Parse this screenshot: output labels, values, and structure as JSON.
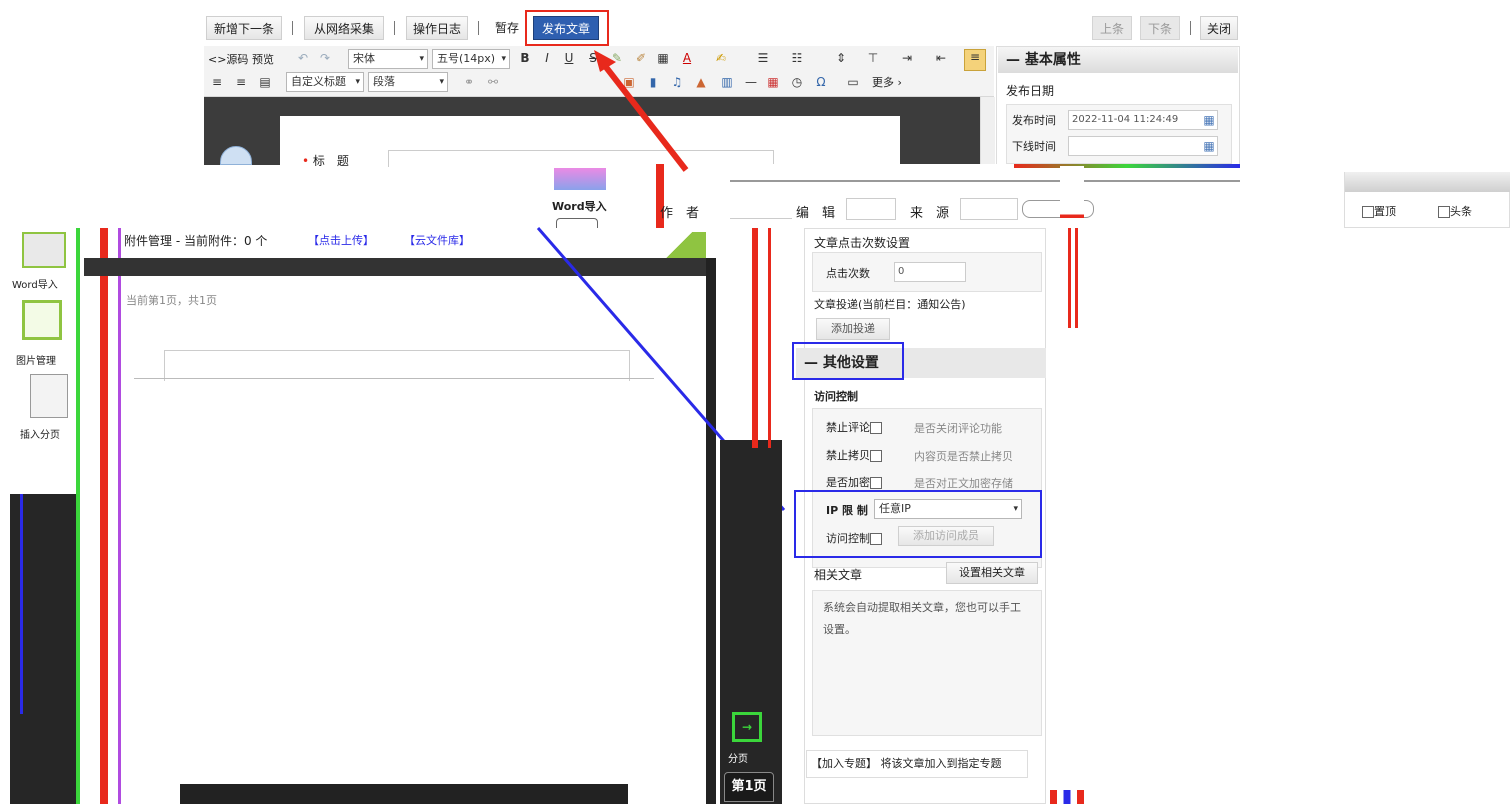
{
  "toolbar": {
    "new_next": "新增下一条",
    "collect": "从网络采集",
    "op_log": "操作日志",
    "draft": "暂存",
    "publish": "发布文章",
    "prev": "上条",
    "next": "下条",
    "close": "关闭"
  },
  "editor": {
    "source": "<>源码",
    "preview": "预览",
    "font_family": "宋体",
    "font_size": "五号(14px)",
    "custom_title": "自定义标题",
    "paragraph": "段落",
    "more": "更多",
    "title_label": "标　题",
    "word_import": "Word导入",
    "author_label": "作　者",
    "editor_label": "编　辑",
    "source_label": "来　源"
  },
  "attachments": {
    "text": "附件管理 - 当前附件：0 个",
    "upload": "【点击上传】",
    "cloud": "【云文件库】",
    "current_doc": "当前第1页，共1页"
  },
  "left_icons": {
    "word_import": "Word导入",
    "image_manage": "图片管理",
    "insert_page": "插入分页"
  },
  "pager": {
    "page": "第1页",
    "split": "分页"
  },
  "basic_props": {
    "header": "基本属性",
    "publish_date": "发布日期",
    "publish_time_label": "发布时间",
    "publish_time_value": "2022-11-04 11:24:49",
    "offline_time_label": "下线时间",
    "offline_time_value": "",
    "top_label": "置顶",
    "headline_label": "头条"
  },
  "click_settings": {
    "title": "文章点击次数设置",
    "count_label": "点击次数",
    "count_value": "0"
  },
  "column": {
    "title": "文章投递(当前栏目：通知公告)",
    "add_btn": "添加投递"
  },
  "other": {
    "header": "其他设置",
    "access_control": "访问控制",
    "no_comment": "禁止评论",
    "no_comment_hint": "是否关闭评论功能",
    "no_copy": "禁止拷贝",
    "no_copy_hint": "内容页是否禁止拷贝",
    "encrypt": "是否加密",
    "encrypt_hint": "是否对正文加密存储",
    "ip_label": "IP 限 制",
    "ip_value": "任意IP",
    "visit_label": "访问控制",
    "visit_btn": "添加访问成员"
  },
  "related": {
    "title": "相关文章",
    "btn": "设置相关文章",
    "desc": "系统会自动提取相关文章，您也可以手工设置。"
  },
  "topic": {
    "text": "【加入专题】 将该文章加入到指定专题"
  },
  "colors": {
    "publish_bg": "#2e5fb0",
    "red_annotation": "#e8291c",
    "blue_annotation": "#2a2ae8"
  }
}
